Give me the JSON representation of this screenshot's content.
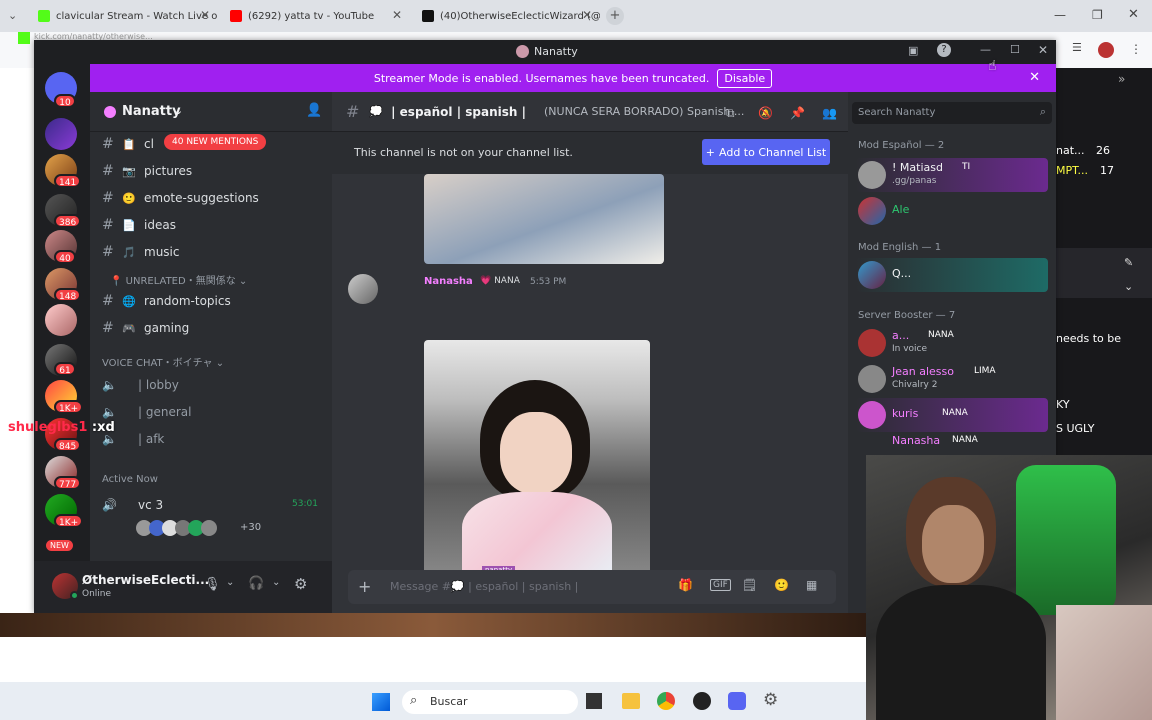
{
  "browser": {
    "tabs": [
      {
        "title": "clavicular Stream - Watch Live o",
        "color": "#53fc18"
      },
      {
        "title": "(6292) yatta tv - YouTube",
        "color": "#ff0000"
      },
      {
        "title": "(40)OtherwiseEclecticWizard (@",
        "color": "#111111"
      }
    ],
    "address": "kick.com/nanatty/otherwise..."
  },
  "window": {
    "title": "Nanatty"
  },
  "streamer_mode": {
    "message": "Streamer Mode is enabled. Usernames have been truncated.",
    "disable_label": "Disable"
  },
  "server": {
    "name": "Nanatty"
  },
  "guild_badges": [
    "10",
    "141",
    "386",
    "40",
    "148",
    "61",
    "1K+",
    "845",
    "777",
    "1K+",
    "NEW"
  ],
  "channels": {
    "mentions_pill": "40 NEW MENTIONS",
    "text": [
      {
        "name": "cl",
        "emoji": "📋"
      },
      {
        "name": "pictures",
        "emoji": "📷"
      },
      {
        "name": "emote-suggestions",
        "emoji": "🙂"
      },
      {
        "name": "ideas",
        "emoji": "📄"
      },
      {
        "name": "music",
        "emoji": "🎵"
      }
    ],
    "unrelated_category": "UNRELATED・無関係な",
    "unrelated": [
      {
        "name": "random-topics",
        "emoji": "🌐"
      },
      {
        "name": "gaming",
        "emoji": "🎮"
      }
    ],
    "voice_category": "VOICE CHAT・ボイチャ",
    "voice": [
      "| lobby",
      "| general",
      "| afk"
    ],
    "active_now": "Active Now",
    "active_vc": "vc 3",
    "active_time": "53:01",
    "active_more": "+30"
  },
  "user": {
    "name": "ØtherwiseEclecti...",
    "status": "Online"
  },
  "chat": {
    "channel": "| español | spanish |",
    "topic": "(NUNCA SERA BORRADO) Spanish ...",
    "notice": "This channel is not on your channel list.",
    "add_button": "Add to Channel List",
    "author": "Nanasha",
    "author_tag": "NANA",
    "time": "5:53 PM",
    "watermark": "nanatty",
    "composer_placeholder": "Message #💭 | español | spanish |"
  },
  "search": {
    "placeholder": "Search Nanatty"
  },
  "members": {
    "groups": [
      {
        "label": "Mod Español — 2",
        "items": [
          {
            "name": "! Matiasd",
            "tag": "TI",
            "sub": ".gg/panas",
            "color": "#f2f3f5"
          },
          {
            "name": "Ale",
            "tag": "",
            "sub": "",
            "color": "#2dc770"
          }
        ]
      },
      {
        "label": "Mod English — 1",
        "items": [
          {
            "name": "Q...",
            "tag": "",
            "sub": "",
            "color": "#f2f3f5"
          }
        ]
      },
      {
        "label": "Server Booster — 7",
        "items": [
          {
            "name": "a...",
            "tag": "NANA",
            "sub": "In voice",
            "color": "#f47fff"
          },
          {
            "name": "Jean alesso",
            "tag": "LIMA",
            "sub": "Chivalry 2",
            "color": "#f47fff"
          },
          {
            "name": "kuris",
            "tag": "NANA",
            "sub": "",
            "color": "#f47fff"
          },
          {
            "name": "Nanasha",
            "tag": "NANA",
            "sub": "",
            "color": "#f47fff"
          }
        ]
      }
    ]
  },
  "overlay": {
    "chat_user": "shuleglbs1",
    "chat_msg": ":xd"
  },
  "right_panel_snippets": [
    "nat...",
    "MPT...",
    "26",
    "17",
    "needs to be",
    "KY",
    "S UGLY"
  ],
  "taskbar": {
    "search": "Buscar"
  },
  "colors": {
    "accent": "#5865f2",
    "streamer_bar": "#a020f0",
    "booster": "#f47fff",
    "danger": "#f23f43"
  }
}
